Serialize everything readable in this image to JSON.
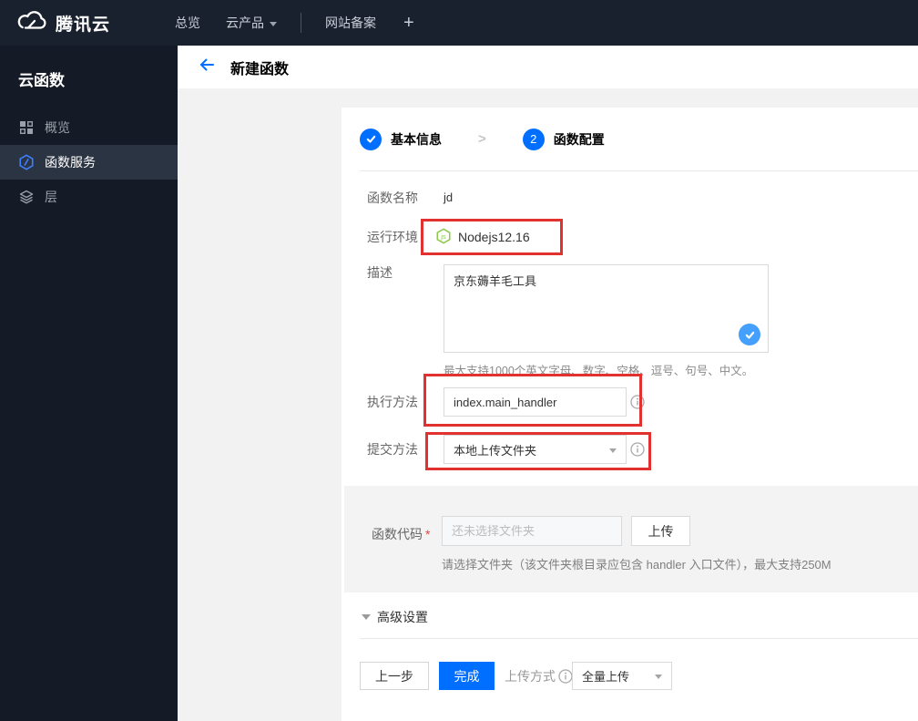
{
  "topbar": {
    "brand": "腾讯云",
    "overview": "总览",
    "products": "云产品",
    "beian": "网站备案",
    "plus": "+"
  },
  "sidebar": {
    "title": "云函数",
    "items": [
      {
        "label": "概览",
        "icon": "grid-icon"
      },
      {
        "label": "函数服务",
        "icon": "function-hexagon-icon"
      },
      {
        "label": "层",
        "icon": "layers-icon"
      }
    ]
  },
  "header": {
    "title": "新建函数"
  },
  "steps": {
    "step1": {
      "label": "基本信息",
      "state": "done"
    },
    "step2": {
      "label": "函数配置",
      "number": "2",
      "state": "current"
    }
  },
  "form": {
    "name": {
      "label": "函数名称",
      "value": "jd"
    },
    "runtime": {
      "label": "运行环境",
      "value": "Nodejs12.16",
      "icon": "nodejs-icon"
    },
    "description": {
      "label": "描述",
      "value": "京东薅羊毛工具",
      "hint": "最大支持1000个英文字母、数字、空格、逗号、句号、中文。"
    },
    "handler": {
      "label": "执行方法",
      "value": "index.main_handler"
    },
    "submit_method": {
      "label": "提交方法",
      "value": "本地上传文件夹"
    },
    "code": {
      "label": "函数代码",
      "required_mark": "*",
      "placeholder": "还未选择文件夹",
      "upload_label": "上传",
      "hint": "请选择文件夹（该文件夹根目录应包含 handler 入口文件），最大支持250M"
    },
    "advanced_label": "高级设置"
  },
  "footer": {
    "prev_label": "上一步",
    "finish_label": "完成",
    "upload_mode_label": "上传方式",
    "upload_mode_value": "全量上传"
  },
  "colors": {
    "accent_blue": "#006eff",
    "check_blue": "#459ffc",
    "annotation_red": "#e23230",
    "node_green": "#8cc84b",
    "topbar_bg": "#1a212e",
    "sidebar_bg": "#151b26",
    "sidebar_active_bg": "#2b3443",
    "page_bg": "#f2f2f2"
  }
}
